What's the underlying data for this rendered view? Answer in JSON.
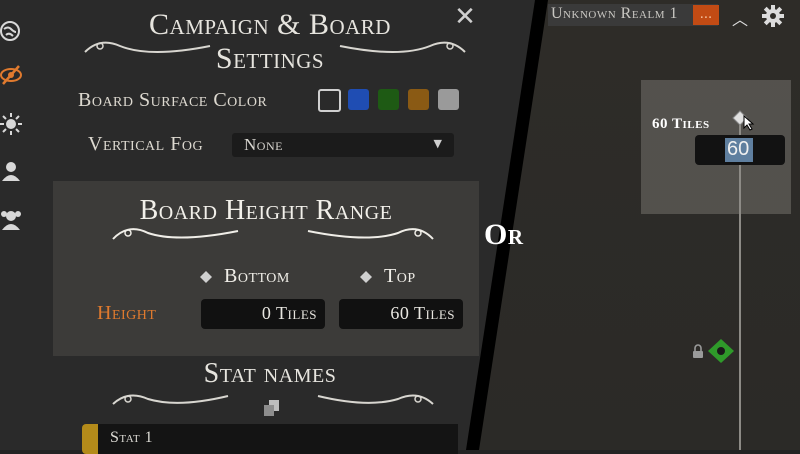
{
  "panel": {
    "title_line1": "Campaign & Board",
    "title_line2": "Settings",
    "board_surface_label": "Board Surface Color",
    "surface_colors": [
      "#2a2a2a",
      "#1f4db3",
      "#1e5a14",
      "#8a5a14",
      "#9a9a9a"
    ],
    "vertical_fog_label": "Vertical Fog",
    "vertical_fog_value": "None",
    "range_title": "Board Height Range",
    "bottom_label": "Bottom",
    "top_label": "Top",
    "height_label": "Height",
    "bottom_value": "0 Tiles",
    "top_value": "60 Tiles",
    "stat_title": "Stat names",
    "stat_rows": [
      "Stat 1"
    ]
  },
  "or_label": "Or",
  "topbar": {
    "realm_name": "Unknown Realm 1",
    "more_label": "..."
  },
  "height_widget": {
    "label": "60 Tiles",
    "value": "60"
  },
  "colors": {
    "accent_orange": "#e07a2e",
    "realm_badge": "#c24b14",
    "stat_bar": "#b48b1a",
    "marker_green": "#2f9a2a"
  },
  "icons": [
    "globe-icon",
    "hidden-eye-icon",
    "sun-icon",
    "person-icon",
    "group-icon",
    "close-icon",
    "dropdown-arrow-icon",
    "diamond-icon",
    "copy-icon",
    "chevron-up-icon",
    "gear-icon",
    "lock-icon",
    "marker-icon",
    "cursor-icon"
  ]
}
